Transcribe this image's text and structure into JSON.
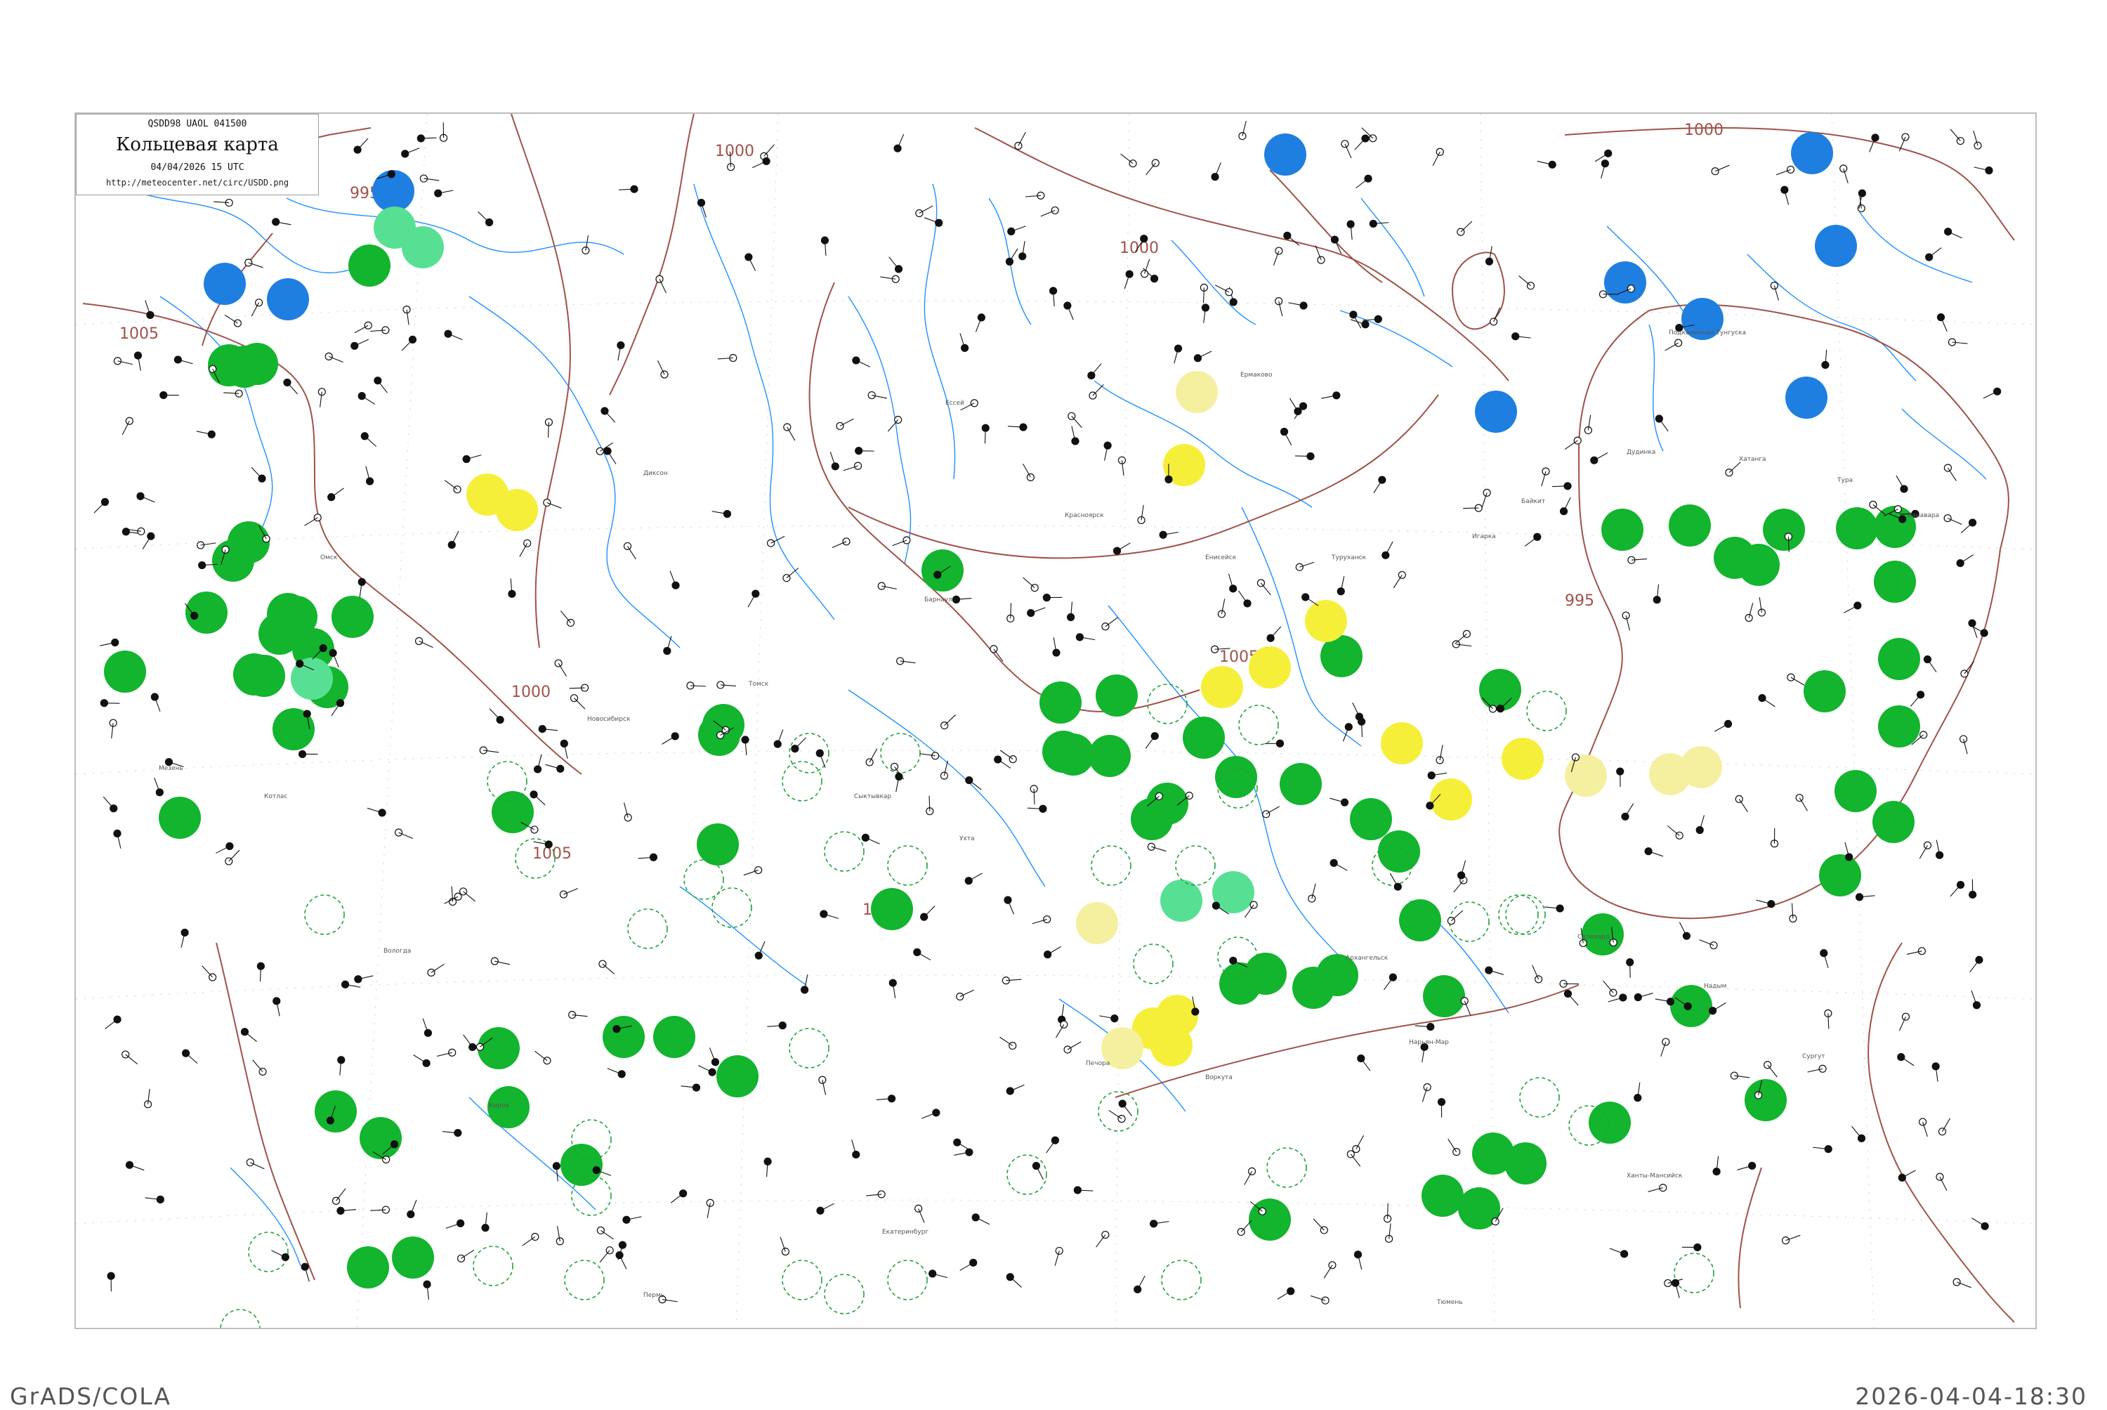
{
  "header": {
    "code_line": "QSDD98  UAOL  041500",
    "title": "Кольцевая карта",
    "timestamp": "04/04/2026 15 UTC",
    "url": "http://meteocenter.net/circ/USDD.png"
  },
  "footer": {
    "software": "GrADS/COLA",
    "generated": "2026-04-04-18:30"
  },
  "colors": {
    "isobar": "#a0524a",
    "river": "#1e90ff",
    "station_blue": "#1f7fe0",
    "station_green": "#13b42e",
    "station_lightgreen": "#57e094",
    "station_yellow": "#f5ef3a",
    "station_paleyellow": "#f5f0a0",
    "station_ring": "#22a33a"
  },
  "isobar_labels": [
    "995",
    "1000",
    "1005",
    "1000",
    "1005",
    "1000",
    "1005",
    "995",
    "1000",
    "1005"
  ],
  "station_names": [
    "Архангельск",
    "Нарьян-Мар",
    "Сыктывкар",
    "Ухта",
    "Печора",
    "Воркута",
    "Салехард",
    "Надым",
    "Сургут",
    "Ханты-Мансийск",
    "Тобольск",
    "Тюмень",
    "Екатеринбург",
    "Пермь",
    "Киров",
    "Вологда",
    "Котлас",
    "Мезень",
    "Омск",
    "Новосибирск",
    "Томск",
    "Барнаул",
    "Красноярск",
    "Енисейск",
    "Туруханск",
    "Игарка",
    "Дудинка",
    "Хатанга",
    "Тура",
    "Ванавара",
    "Подкаменная Тунгуска",
    "Байкит",
    "Ермаково",
    "Ессей",
    "Диксон"
  ]
}
